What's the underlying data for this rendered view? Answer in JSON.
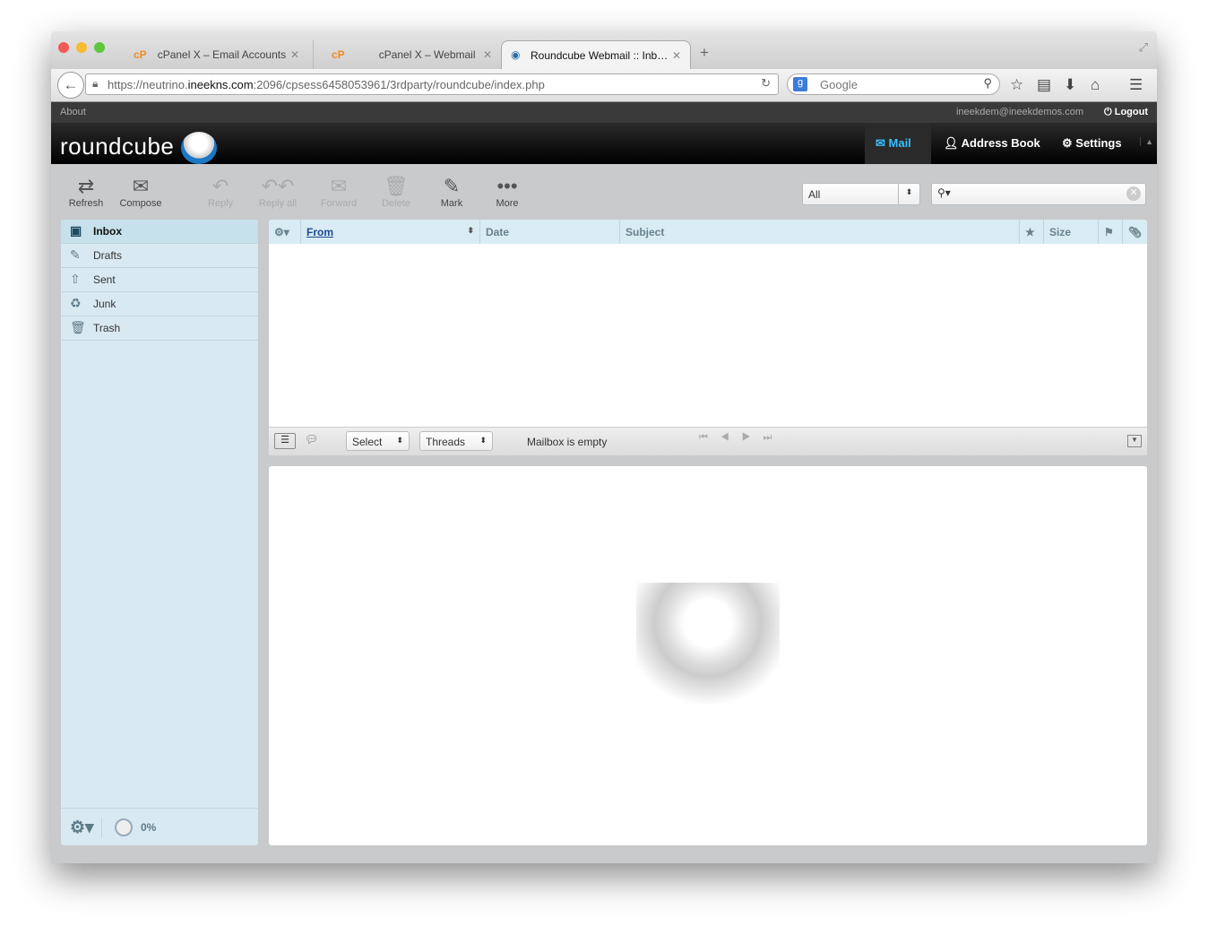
{
  "browser": {
    "tabs": [
      {
        "label": "cPanel X – Email Accounts",
        "icon": "cP"
      },
      {
        "label": "cPanel X – Webmail",
        "icon": "cP"
      },
      {
        "label": "Roundcube Webmail :: Inb…",
        "icon": "roundcube-icon",
        "active": true
      }
    ],
    "url_prefix": "https://neutrino.",
    "url_domain": "ineekns.com",
    "url_rest": ":2096/cpsess6458053961/3rdparty/roundcube/index.php",
    "search_placeholder": "Google"
  },
  "app": {
    "about": "About",
    "user": "ineekdem@ineekdemos.com",
    "logout": "Logout",
    "logo": "roundcube",
    "nav": [
      {
        "label": "Mail",
        "active": true
      },
      {
        "label": "Address Book"
      },
      {
        "label": "Settings"
      }
    ],
    "toolbar": [
      {
        "label": "Refresh",
        "enabled": true
      },
      {
        "label": "Compose",
        "enabled": true
      },
      {
        "label": "Reply",
        "enabled": false
      },
      {
        "label": "Reply all",
        "enabled": false
      },
      {
        "label": "Forward",
        "enabled": false
      },
      {
        "label": "Delete",
        "enabled": false
      },
      {
        "label": "Mark",
        "enabled": true
      },
      {
        "label": "More",
        "enabled": true
      }
    ],
    "filter": "All",
    "search_value": "",
    "folders": [
      "Inbox",
      "Drafts",
      "Sent",
      "Junk",
      "Trash"
    ],
    "quota": "0%",
    "columns": {
      "from": "From",
      "date": "Date",
      "subject": "Subject",
      "size": "Size"
    },
    "list_footer": {
      "select": "Select",
      "threads": "Threads",
      "status": "Mailbox is empty"
    },
    "accent": "#37beff"
  }
}
